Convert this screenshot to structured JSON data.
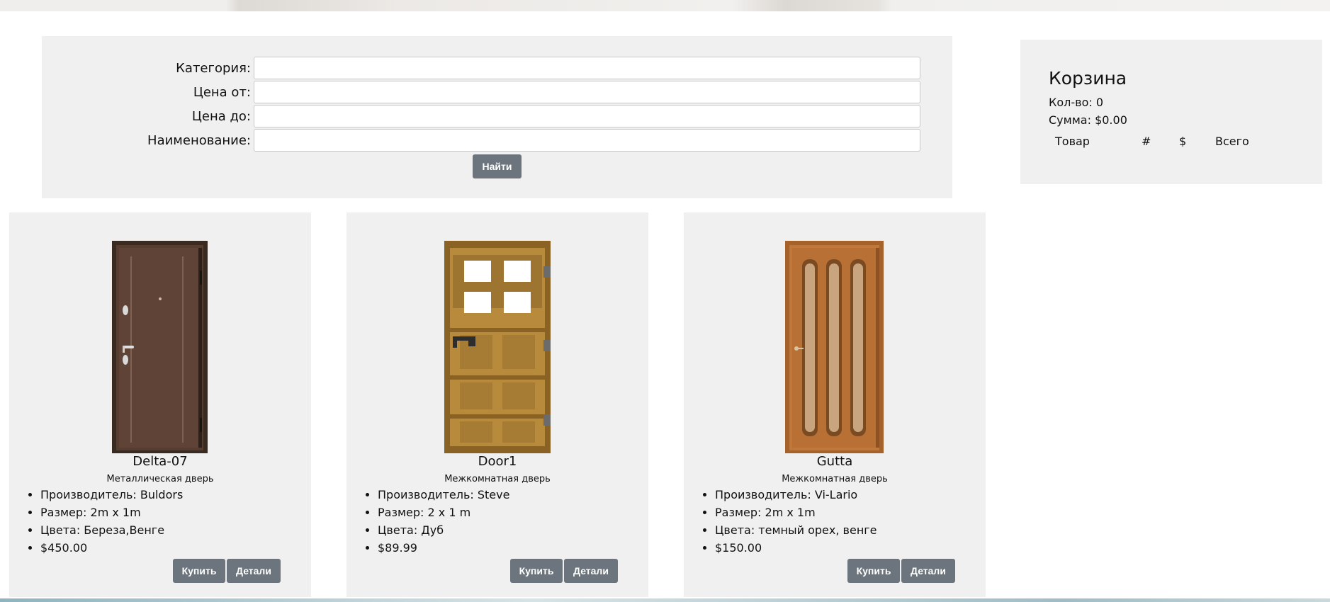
{
  "search": {
    "category_label": "Категория:",
    "price_from_label": "Цена от:",
    "price_to_label": "Цена до:",
    "name_label": "Наименование:",
    "category_value": "",
    "price_from_value": "",
    "price_to_value": "",
    "name_value": "",
    "submit_label": "Найти"
  },
  "cart": {
    "title": "Корзина",
    "count_text": "Кол-во: 0",
    "sum_text": "Сумма: $0.00",
    "columns": [
      "Товар",
      "#",
      "$",
      "Всего"
    ]
  },
  "products": [
    {
      "name": "Delta-07",
      "type": "Металлическая дверь",
      "manufacturer": "Производитель: Buldors",
      "size": "Размер: 2m x 1m",
      "colors": "Цвета: Береза,Венге",
      "price": "$450.00",
      "buy_label": "Купить",
      "details_label": "Детали",
      "image_icon": "metal-door-image"
    },
    {
      "name": "Door1",
      "type": "Межкомнатная дверь",
      "manufacturer": "Производитель: Steve",
      "size": "Размер: 2 x 1 m",
      "colors": "Цвета: Дуб",
      "price": "$89.99",
      "buy_label": "Купить",
      "details_label": "Детали",
      "image_icon": "pixel-wooden-door-image"
    },
    {
      "name": "Gutta",
      "type": "Межкомнатная дверь",
      "manufacturer": "Производитель: Vi-Lario",
      "size": "Размер: 2m x 1m",
      "colors": "Цвета: темный орех, венге",
      "price": "$150.00",
      "buy_label": "Купить",
      "details_label": "Детали",
      "image_icon": "glazed-wooden-door-image"
    }
  ],
  "colors": {
    "panel_bg": "#f0f0f0",
    "button_bg": "#6c757d",
    "button_text": "#ffffff"
  }
}
